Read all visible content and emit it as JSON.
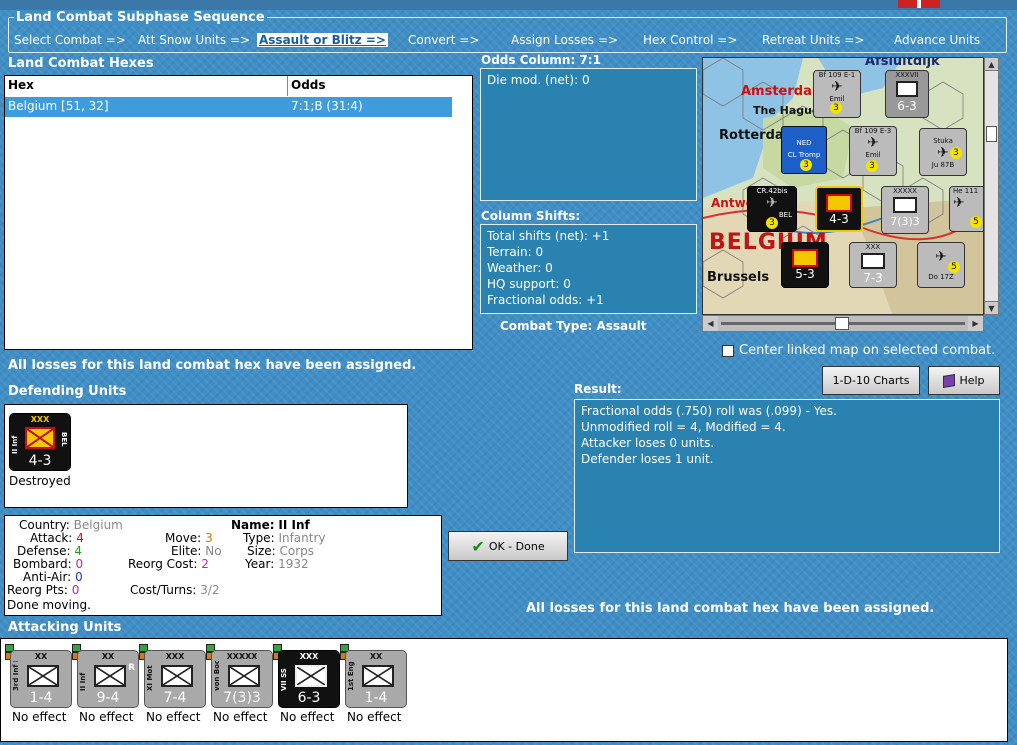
{
  "sequence": {
    "title": "Land Combat Subphase Sequence",
    "steps": [
      {
        "label": "Select Combat =>",
        "active": false
      },
      {
        "label": "Att Snow Units =>",
        "active": false
      },
      {
        "label": "Assault or Blitz =>",
        "active": true
      },
      {
        "label": "Convert =>",
        "active": false
      },
      {
        "label": "Assign Losses =>",
        "active": false
      },
      {
        "label": "Hex Control =>",
        "active": false
      },
      {
        "label": "Retreat Units =>",
        "active": false
      },
      {
        "label": "Advance Units",
        "active": false
      }
    ]
  },
  "hexes_table": {
    "title": "Land Combat Hexes",
    "col_hex": "Hex",
    "col_odds": "Odds",
    "rows": [
      {
        "hex": "Belgium [51, 32]",
        "odds": "7:1;B (31:4)"
      }
    ]
  },
  "odds_column": {
    "title": "Odds Column: 7:1",
    "die_mod": "Die mod. (net): 0"
  },
  "column_shifts": {
    "title": "Column Shifts:",
    "lines": [
      "Total shifts (net): +1",
      "Terrain: 0",
      "Weather: 0",
      "HQ support: 0",
      "Fractional odds: +1"
    ]
  },
  "combat_type": "Combat Type:  Assault",
  "losses_msg_top": "All losses for this land combat hex have been assigned.",
  "losses_msg_bottom": "All losses for this land combat hex have been assigned.",
  "center_map_label": "Center linked map on selected combat.",
  "buttons": {
    "charts": "1-D-10 Charts",
    "help": "Help",
    "ok": "OK - Done"
  },
  "result": {
    "title": "Result:",
    "lines": [
      "Fractional odds (.750) roll was (.099)  - Yes.",
      "Unmodified roll = 4, Modified = 4.",
      "Attacker loses 0 units.",
      "Defender loses 1 unit."
    ]
  },
  "defending": {
    "title": "Defending Units",
    "unit": {
      "size": "XXX",
      "name": "II Inf",
      "strength": "4-3",
      "nation": "BEL",
      "status": "Destroyed"
    }
  },
  "unit_info": {
    "country_label": "Country:",
    "country": "Belgium",
    "attack_label": "Attack:",
    "attack": "4",
    "defense_label": "Defense:",
    "defense": "4",
    "bombard_label": "Bombard:",
    "bombard": "0",
    "antiair_label": "Anti-Air:",
    "antiair": "0",
    "reorg_pts_label": "Reorg Pts:",
    "reorg_pts": "0",
    "done_moving": "Done moving.",
    "move_label": "Move:",
    "move": "3",
    "elite_label": "Elite:",
    "elite": "No",
    "reorg_cost_label": "Reorg Cost:",
    "reorg_cost": "2",
    "cost_turns_label": "Cost/Turns:",
    "cost_turns": "3/2",
    "name_label": "Name:",
    "name": "II Inf",
    "type_label": "Type:",
    "type": "Infantry",
    "size_label": "Size:",
    "size": "Corps",
    "year_label": "Year:",
    "year": "1932"
  },
  "attacking": {
    "title": "Attacking Units",
    "units": [
      {
        "size": "XX",
        "name": "3rd Inf Div",
        "strength": "1-4",
        "status": "No effect",
        "dark": false,
        "corner": ""
      },
      {
        "size": "XX",
        "name": "II Inf",
        "strength": "9-4",
        "status": "No effect",
        "dark": false,
        "corner": "R"
      },
      {
        "size": "XXX",
        "name": "XI Mot",
        "strength": "7-4",
        "status": "No effect",
        "dark": false,
        "corner": ""
      },
      {
        "size": "XXXXX",
        "name": "von Bock",
        "strength": "7(3)3",
        "status": "No effect",
        "dark": false,
        "corner": ""
      },
      {
        "size": "XXX",
        "name": "VII SS",
        "strength": "6-3",
        "status": "No effect",
        "dark": true,
        "corner": ""
      },
      {
        "size": "XX",
        "name": "1st Eng",
        "strength": "1-4",
        "status": "No effect",
        "dark": false,
        "corner": ""
      }
    ]
  },
  "map": {
    "places": [
      "Afsluitdijk",
      "Amsterdam",
      "The Hague",
      "Rotterdam",
      "Antwerp",
      "BELGIUM",
      "Brussels"
    ],
    "counters": [
      {
        "top": "Bf 109 E-1",
        "mid": "Emil",
        "val": "3"
      },
      {
        "top": "XXXVII",
        "mid": "",
        "val": "6-3"
      },
      {
        "top": "NED",
        "mid": "CL Tromp",
        "val": "3"
      },
      {
        "top": "Bf 109 E-3",
        "mid": "Emil",
        "val": "3"
      },
      {
        "top": "Stuka",
        "mid": "Ju 87B",
        "val": "3"
      },
      {
        "top": "CR.42bis",
        "mid": "BEL",
        "val": "3"
      },
      {
        "top": "II Inf",
        "mid": "BEL",
        "val": "4-3"
      },
      {
        "top": "XXXXX",
        "mid": "",
        "val": "7(3)3"
      },
      {
        "top": "He 111",
        "mid": "",
        "val": "5"
      },
      {
        "top": "I Inf",
        "mid": "BEL",
        "val": "5-3"
      },
      {
        "top": "XXX",
        "mid": "",
        "val": "7-3"
      },
      {
        "top": "Do 17Z",
        "mid": "",
        "val": "5"
      }
    ]
  },
  "colors": {
    "accent": "#3f8ec6",
    "panel": "#2a82b0",
    "selected": "#3e9cdc"
  }
}
